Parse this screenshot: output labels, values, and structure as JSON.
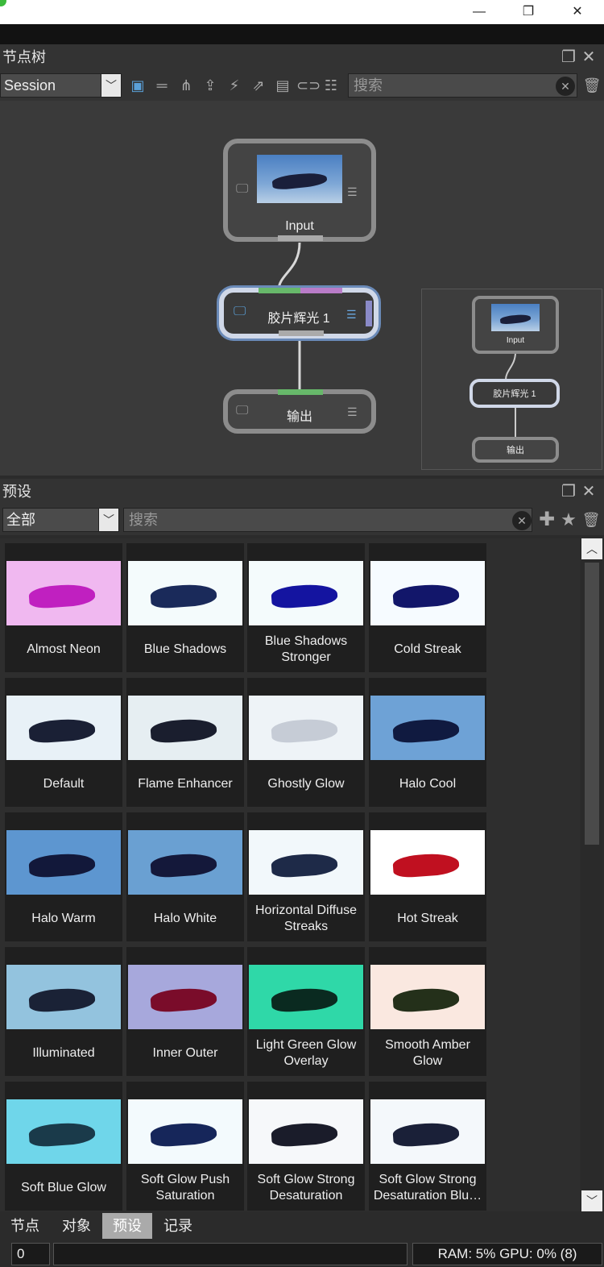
{
  "window": {
    "min": "—",
    "max": "❐",
    "close": "✕"
  },
  "node_tree": {
    "title": "节点树",
    "session_select": "Session",
    "search_placeholder": "搜索",
    "nodes": {
      "input": "Input",
      "effect": "胶片辉光 1",
      "output": "输出"
    }
  },
  "presets": {
    "title": "预设",
    "filter_select": "全部",
    "search_placeholder": "搜索",
    "items": [
      {
        "label": "Almost Neon",
        "bg": "#f0b8f0",
        "fig": "#c020c0"
      },
      {
        "label": "Blue Shadows",
        "bg": "#f4fbfc",
        "fig": "#1a2a5a"
      },
      {
        "label": "Blue Shadows Stronger",
        "bg": "#f4fbfc",
        "fig": "#1414a0"
      },
      {
        "label": "Cold Streak",
        "bg": "#f6fbff",
        "fig": "#12166a"
      },
      {
        "label": "Default",
        "bg": "#e8f1f7",
        "fig": "#1a2035"
      },
      {
        "label": "Flame Enhancer",
        "bg": "#e6eef2",
        "fig": "#1a1e2e"
      },
      {
        "label": "Ghostly Glow",
        "bg": "#eef3f7",
        "fig": "#c6ccd6"
      },
      {
        "label": "Halo Cool",
        "bg": "#6ea2d6",
        "fig": "#101a40"
      },
      {
        "label": "Halo Warm",
        "bg": "#5d96d0",
        "fig": "#12183a"
      },
      {
        "label": "Halo White",
        "bg": "#6aa0d2",
        "fig": "#14183a"
      },
      {
        "label": "Horizontal Diffuse Streaks",
        "bg": "#f2f8fb",
        "fig": "#1e2a48"
      },
      {
        "label": "Hot Streak",
        "bg": "#ffffff",
        "fig": "#c01020"
      },
      {
        "label": "Illuminated",
        "bg": "#93c3de",
        "fig": "#1a2236"
      },
      {
        "label": "Inner Outer",
        "bg": "#a7a8dc",
        "fig": "#7a0c2a"
      },
      {
        "label": "Light Green Glow Overlay",
        "bg": "#2fd8a8",
        "fig": "#0a2a20"
      },
      {
        "label": "Smooth Amber Glow",
        "bg": "#fae8e0",
        "fig": "#24301a"
      },
      {
        "label": "Soft Blue Glow",
        "bg": "#6fd6ea",
        "fig": "#1a3a4a"
      },
      {
        "label": "Soft Glow Push Saturation",
        "bg": "#f3fafd",
        "fig": "#16265a"
      },
      {
        "label": "Soft Glow Strong Desaturation",
        "bg": "#f6f8fa",
        "fig": "#1a1c2a"
      },
      {
        "label": "Soft Glow Strong Desaturation Blu…",
        "bg": "#f4f8fb",
        "fig": "#1a2038"
      }
    ]
  },
  "tabs": [
    "节点",
    "对象",
    "预设",
    "记录"
  ],
  "status": {
    "time": "0 ms",
    "resources": "RAM: 5% GPU: 0% (8)"
  }
}
